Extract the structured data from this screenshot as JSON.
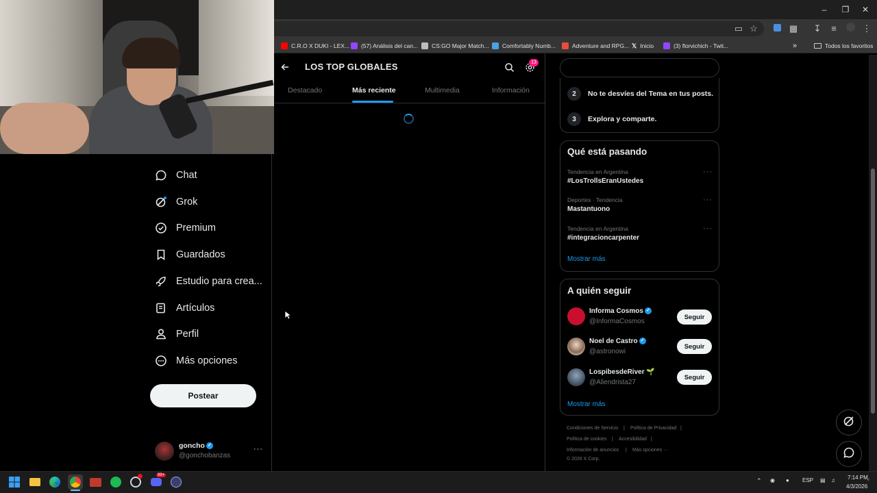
{
  "browser": {
    "bookmarks": [
      {
        "label": "C.R.O X DUKI - LEX...",
        "color": "#ff0000"
      },
      {
        "label": "(57) Análisis del can...",
        "color": "#9146ff"
      },
      {
        "label": "CS:GO Major Match...",
        "color": "#bdbdbd"
      },
      {
        "label": "Comfortably Numb...",
        "color": "#4aa3df"
      },
      {
        "label": "Adventure and RPG...",
        "color": "#e74c3c"
      },
      {
        "label": "Inicio",
        "color": "#ffffff"
      },
      {
        "label": "(3) florvichich - Twit...",
        "color": "#9146ff"
      }
    ],
    "all_bookmarks_label": "Todos los favoritos",
    "overflow_label": "»"
  },
  "nav": {
    "items": [
      {
        "label": "Chat",
        "icon": "chat-bubble-icon"
      },
      {
        "label": "Grok",
        "icon": "grok-icon"
      },
      {
        "label": "Premium",
        "icon": "premium-badge-icon"
      },
      {
        "label": "Guardados",
        "icon": "bookmark-icon"
      },
      {
        "label": "Estudio para crea...",
        "icon": "rocket-icon"
      },
      {
        "label": "Artículos",
        "icon": "article-icon"
      },
      {
        "label": "Perfil",
        "icon": "person-icon"
      },
      {
        "label": "Más opciones",
        "icon": "more-circle-icon"
      }
    ],
    "post_label": "Postear",
    "account": {
      "name": "goncho",
      "handle": "@gonchobanzas",
      "more": "···"
    }
  },
  "main": {
    "title": "LOS TOP GLOBALES",
    "notification_count": "13",
    "tabs": [
      {
        "label": "Destacado",
        "active": false
      },
      {
        "label": "Más reciente",
        "active": true
      },
      {
        "label": "Multimedia",
        "active": false
      },
      {
        "label": "Información",
        "active": false
      }
    ]
  },
  "sidebar": {
    "search_placeholder": "Buscar",
    "rules": [
      {
        "num": "2",
        "text": "No te desvíes del Tema en tus posts."
      },
      {
        "num": "3",
        "text": "Explora y comparte."
      }
    ],
    "trends": {
      "title": "Qué está pasando",
      "items": [
        {
          "meta": "Tendencia en Argentina",
          "name": "#LosTrollsEranUstedes"
        },
        {
          "meta": "Deportes · Tendencia",
          "name": "Mastantuono"
        },
        {
          "meta": "Tendencia en Argentina",
          "name": "#integracioncarpenter"
        }
      ],
      "show_more": "Mostrar más"
    },
    "who_to_follow": {
      "title": "A quién seguir",
      "users": [
        {
          "name": "Informa Cosmos",
          "handle": "@InformaCosmos",
          "verified": true,
          "button": "Seguir"
        },
        {
          "name": "Noel de Castro",
          "handle": "@astronowi",
          "verified": true,
          "button": "Seguir"
        },
        {
          "name": "LospibesdeRiver 🌱",
          "handle": "@Aliendrista27",
          "verified": false,
          "button": "Seguir"
        }
      ],
      "show_more": "Mostrar más"
    },
    "footer": {
      "line1a": "Condiciones de Servicio",
      "line1b": "Política de Privacidad",
      "line2a": "Política de cookies",
      "line2b": "Accesibilidad",
      "line3a": "Información de anuncios",
      "line3b": "Más opciones ···",
      "copyright": "© 2026 X Corp."
    }
  },
  "taskbar": {
    "lang": "ESP",
    "time": "7:14 PM",
    "date": "4/3/2026",
    "discord_badge": "99+"
  }
}
